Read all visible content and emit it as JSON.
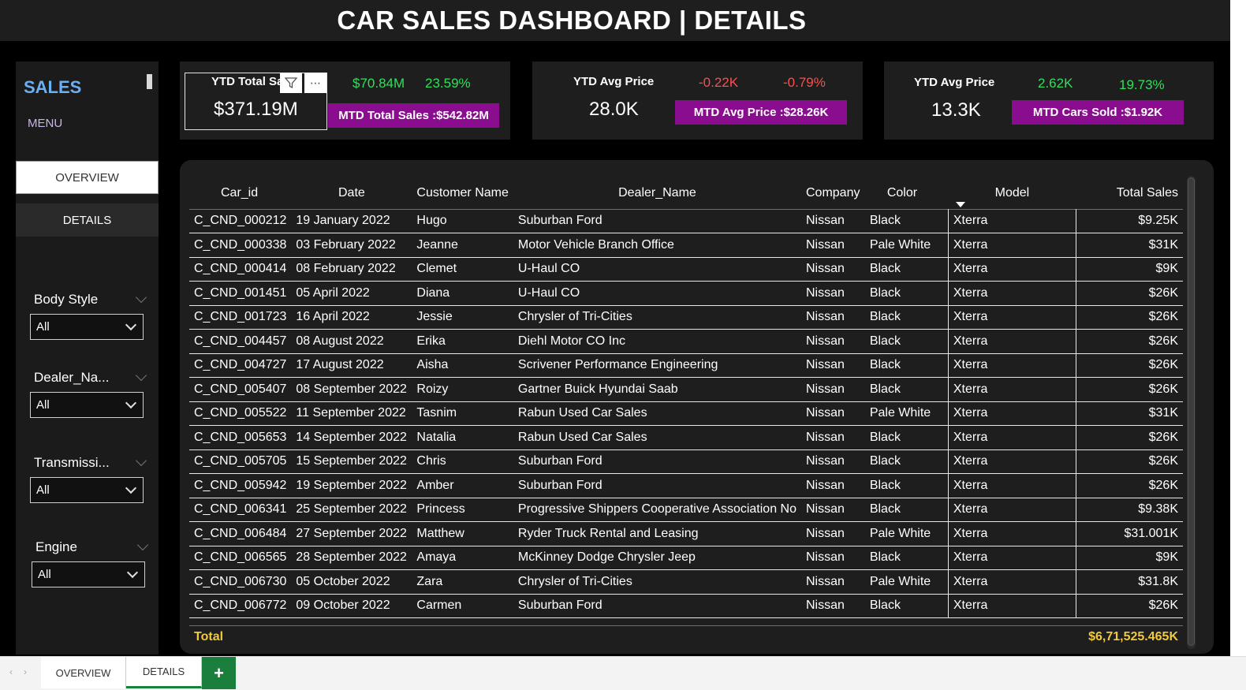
{
  "title": "CAR SALES DASHBOARD | DETAILS",
  "sidebar": {
    "brand": "SALES",
    "menu": "MENU",
    "nav": {
      "overview": "OVERVIEW",
      "details": "DETAILS"
    },
    "slicers": [
      {
        "label": "Body Style",
        "value": "All"
      },
      {
        "label": "Dealer_Na...",
        "value": "All"
      },
      {
        "label": "Transmissi...",
        "value": "All"
      },
      {
        "label": "Engine",
        "value": "All"
      }
    ]
  },
  "cards": {
    "c1": {
      "label": "YTD Total Sa",
      "value": "$371.19M",
      "change_abs": "$70.84M",
      "change_pct": "23.59%",
      "mtd": "MTD Total Sales :$542.82M"
    },
    "c2": {
      "label": "YTD Avg Price",
      "value": "28.0K",
      "change_abs": "-0.22K",
      "change_pct": "-0.79%",
      "mtd": "MTD Avg Price :$28.26K"
    },
    "c3": {
      "label": "YTD Avg Price",
      "value": "13.3K",
      "change_abs": "2.62K",
      "change_pct": "19.73%",
      "mtd": "MTD Cars Sold :$1.92K"
    }
  },
  "icons": {
    "filter": "filter-icon",
    "more": "more-options-icon"
  },
  "colors": {
    "positive": "#2ee05a",
    "negative": "#ff4d4d",
    "mtd_bg": "#8b0d8f",
    "total": "#f0c93c",
    "brand": "#6ab0f3"
  },
  "table": {
    "columns": [
      "Car_id",
      "Date",
      "Customer Name",
      "Dealer_Name",
      "Company",
      "Color",
      "Model",
      "Total Sales"
    ],
    "rows": [
      [
        "C_CND_000212",
        "19 January 2022",
        "Hugo",
        "Suburban Ford",
        "Nissan",
        "Black",
        "Xterra",
        "$9.25K"
      ],
      [
        "C_CND_000338",
        "03 February 2022",
        "Jeanne",
        "Motor Vehicle Branch Office",
        "Nissan",
        "Pale White",
        "Xterra",
        "$31K"
      ],
      [
        "C_CND_000414",
        "08 February 2022",
        "Clemet",
        "U-Haul CO",
        "Nissan",
        "Black",
        "Xterra",
        "$9K"
      ],
      [
        "C_CND_001451",
        "05 April 2022",
        "Diana",
        "U-Haul CO",
        "Nissan",
        "Black",
        "Xterra",
        "$26K"
      ],
      [
        "C_CND_001723",
        "16 April 2022",
        "Jessie",
        "Chrysler of Tri-Cities",
        "Nissan",
        "Black",
        "Xterra",
        "$26K"
      ],
      [
        "C_CND_004457",
        "08 August 2022",
        "Erika",
        "Diehl Motor CO Inc",
        "Nissan",
        "Black",
        "Xterra",
        "$26K"
      ],
      [
        "C_CND_004727",
        "17 August 2022",
        "Aisha",
        "Scrivener Performance Engineering",
        "Nissan",
        "Black",
        "Xterra",
        "$26K"
      ],
      [
        "C_CND_005407",
        "08 September 2022",
        "Roizy",
        "Gartner Buick Hyundai Saab",
        "Nissan",
        "Black",
        "Xterra",
        "$26K"
      ],
      [
        "C_CND_005522",
        "11 September 2022",
        "Tasnim",
        "Rabun Used Car Sales",
        "Nissan",
        "Pale White",
        "Xterra",
        "$31K"
      ],
      [
        "C_CND_005653",
        "14 September 2022",
        "Natalia",
        "Rabun Used Car Sales",
        "Nissan",
        "Black",
        "Xterra",
        "$26K"
      ],
      [
        "C_CND_005705",
        "15 September 2022",
        "Chris",
        "Suburban Ford",
        "Nissan",
        "Black",
        "Xterra",
        "$26K"
      ],
      [
        "C_CND_005942",
        "19 September 2022",
        "Amber",
        "Suburban Ford",
        "Nissan",
        "Black",
        "Xterra",
        "$26K"
      ],
      [
        "C_CND_006341",
        "25 September 2022",
        "Princess",
        "Progressive Shippers Cooperative Association No",
        "Nissan",
        "Black",
        "Xterra",
        "$9.38K"
      ],
      [
        "C_CND_006484",
        "27 September 2022",
        "Matthew",
        "Ryder Truck Rental and Leasing",
        "Nissan",
        "Pale White",
        "Xterra",
        "$31.001K"
      ],
      [
        "C_CND_006565",
        "28 September 2022",
        "Amaya",
        "McKinney Dodge Chrysler Jeep",
        "Nissan",
        "Black",
        "Xterra",
        "$9K"
      ],
      [
        "C_CND_006730",
        "05 October 2022",
        "Zara",
        "Chrysler of Tri-Cities",
        "Nissan",
        "Pale White",
        "Xterra",
        "$31.8K"
      ],
      [
        "C_CND_006772",
        "09 October 2022",
        "Carmen",
        "Suburban Ford",
        "Nissan",
        "Black",
        "Xterra",
        "$26K"
      ]
    ],
    "total_label": "Total",
    "total_value": "$6,71,525.465K"
  },
  "tabs": {
    "overview": "OVERVIEW",
    "details": "DETAILS",
    "add": "+"
  }
}
